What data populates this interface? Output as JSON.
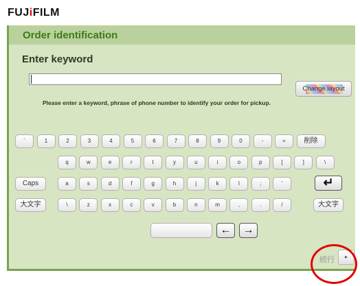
{
  "brand": {
    "logo_left": "FUJ",
    "logo_dot": "i",
    "logo_right": "FILM"
  },
  "header": {
    "title": "Order identification"
  },
  "form": {
    "subtitle": "Enter keyword",
    "input_value": "",
    "hint": "Please enter a keyword, phrase of phone number to identify your order for pickup."
  },
  "buttons": {
    "change_layout": "Change layout",
    "next_label": "続行",
    "next_arrow": "▸"
  },
  "keyboard": {
    "row1": [
      "`",
      "1",
      "2",
      "3",
      "4",
      "5",
      "6",
      "7",
      "8",
      "9",
      "0",
      "-",
      "=",
      "削除"
    ],
    "row2": [
      "q",
      "w",
      "e",
      "r",
      "t",
      "y",
      "u",
      "i",
      "o",
      "p",
      "[",
      "]",
      "\\"
    ],
    "row3": [
      "Caps",
      "a",
      "s",
      "d",
      "f",
      "g",
      "h",
      "j",
      "k",
      "l",
      ";",
      "'",
      "↵"
    ],
    "row4": [
      "大文字",
      "\\",
      "z",
      "x",
      "c",
      "v",
      "b",
      "n",
      "m",
      ",",
      ".",
      "/",
      "大文字"
    ],
    "row5": {
      "space": "",
      "left": "←",
      "right": "→"
    }
  },
  "colors": {
    "panel": "#d7e5c3",
    "header": "#b9d19c",
    "title": "#3f7a18",
    "highlight": "#e00000"
  }
}
